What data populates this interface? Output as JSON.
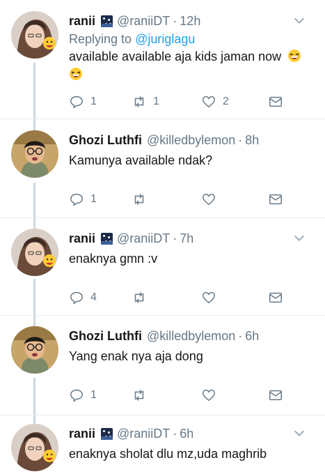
{
  "tweets": [
    {
      "name": "ranii",
      "handle": "@raniiDT",
      "time": "12h",
      "badge": "night-sky-badge",
      "replying_prefix": "Replying to",
      "replying_to": "@jurigl agu",
      "text": "available available aja kids jaman now",
      "emoji": [
        "grinning-squinting-face-emoji",
        "grinning-squinting-face-emoji"
      ],
      "reply_count": "1",
      "retweet_count": "1",
      "like_count": "2"
    },
    {
      "name": "Ghozi Luthfi",
      "handle": "@killedbylemon",
      "time": "8h",
      "text": "Kamunya available ndak?",
      "reply_count": "1",
      "retweet_count": "",
      "like_count": ""
    },
    {
      "name": "ranii",
      "handle": "@raniiDT",
      "time": "7h",
      "badge": "night-sky-badge",
      "text": "enaknya gmn :v",
      "reply_count": "4",
      "retweet_count": "",
      "like_count": ""
    },
    {
      "name": "Ghozi Luthfi",
      "handle": "@killedbylemon",
      "time": "6h",
      "text": "Yang enak nya aja dong",
      "reply_count": "1",
      "retweet_count": "",
      "like_count": ""
    },
    {
      "name": "ranii",
      "handle": "@raniiDT",
      "time": "6h",
      "badge": "night-sky-badge",
      "text": "enaknya sholat dlu mz,uda maghrib"
    }
  ],
  "separator": "·",
  "colors": {
    "text": "#14171a",
    "secondary": "#657786",
    "link": "#1da1f2",
    "thread_line": "#ccd6dd",
    "divider": "#e6ecf0"
  }
}
